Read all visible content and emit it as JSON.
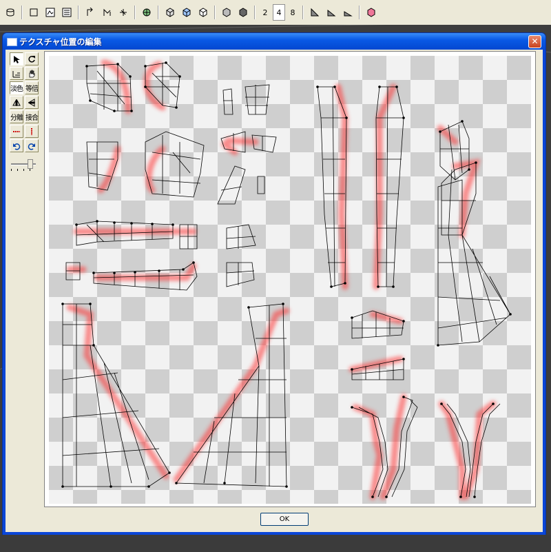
{
  "toolbar": {
    "icons": [
      "cylinder-icon",
      "square-icon",
      "tex-a-icon",
      "tex-b-icon",
      "arrow-split-icon",
      "arrow-merge-icon",
      "arrow-vertex-icon",
      "globe-icon",
      "cube-a-icon",
      "cube-b-icon",
      "cube-c-icon",
      "cube-d-icon",
      "cube-e-icon"
    ],
    "num_2": "2",
    "num_4": "4",
    "num_8": "8",
    "selected_subdivision": "4"
  },
  "dialog": {
    "title": "テクスチャ位置の編集",
    "close_glyph": "✕",
    "ok_label": "OK"
  },
  "palette": {
    "btn_thin_color": "淡色",
    "btn_equal": "等倍",
    "btn_split": "分離",
    "btn_join": "接合"
  },
  "colors": {
    "checker_light": "#f2f2f2",
    "checker_dark": "#cfcfcf",
    "seam_highlight": "#ff4040",
    "title_bar": "#0a5ae6"
  }
}
